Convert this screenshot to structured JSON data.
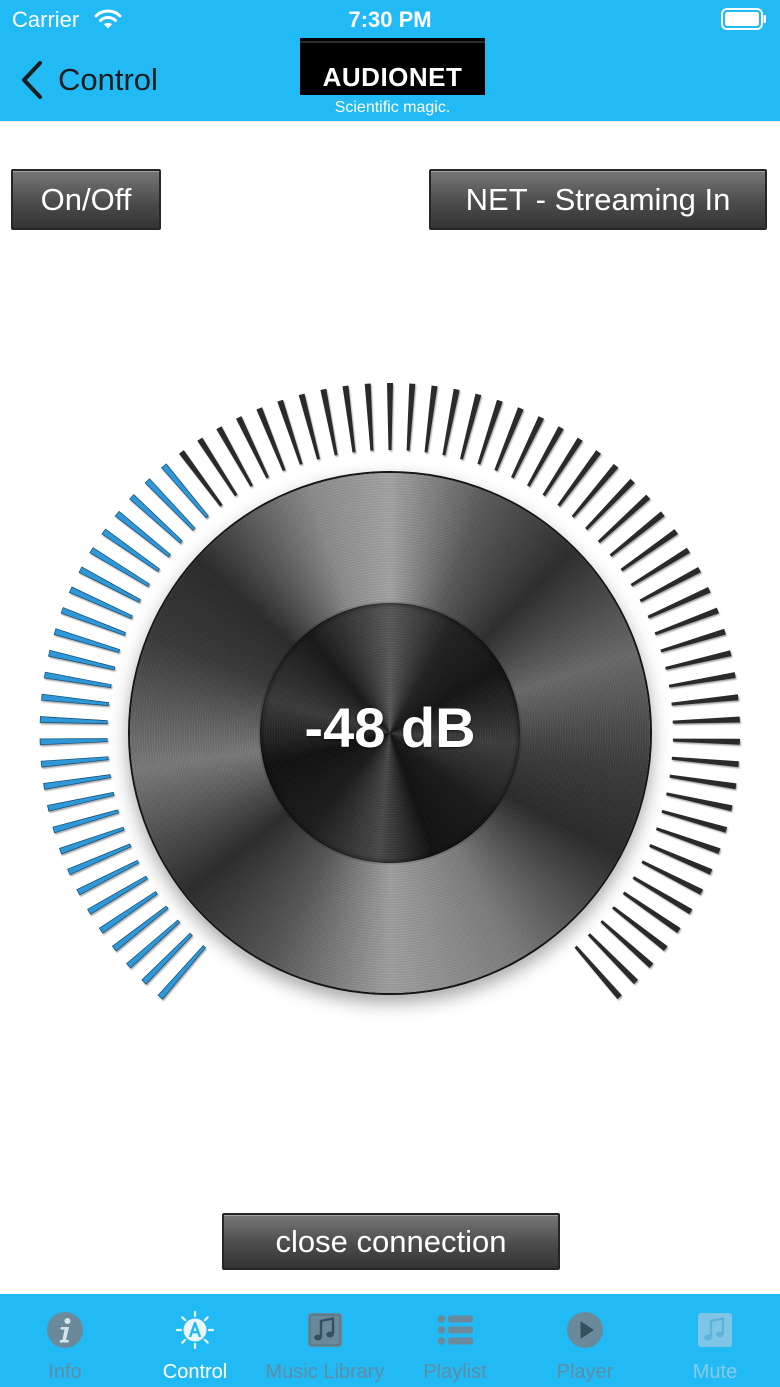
{
  "status_bar": {
    "carrier": "Carrier",
    "time": "7:30 PM",
    "wifi_icon": "wifi-icon",
    "battery_icon": "battery-icon",
    "battery_level": 1.0
  },
  "nav": {
    "back_label": "Control",
    "back_icon": "chevron-left-icon",
    "logo": {
      "brand": "AUDIONET",
      "tagline": "Scientific magic."
    }
  },
  "buttons": {
    "power": "On/Off",
    "input": "NET - Streaming In",
    "close": "close connection"
  },
  "volume": {
    "display": "-48 dB",
    "level": 0.36
  },
  "tabs": [
    {
      "label": "Info",
      "icon": "info-icon",
      "selected": false,
      "disabled": false
    },
    {
      "label": "Control",
      "icon": "control-icon",
      "selected": true,
      "disabled": false
    },
    {
      "label": "Music Library",
      "icon": "music-library-icon",
      "selected": false,
      "disabled": false
    },
    {
      "label": "Playlist",
      "icon": "playlist-icon",
      "selected": false,
      "disabled": false
    },
    {
      "label": "Player",
      "icon": "player-icon",
      "selected": false,
      "disabled": false
    },
    {
      "label": "Mute",
      "icon": "mute-icon",
      "selected": false,
      "disabled": true
    }
  ],
  "colors": {
    "accent": "#22BAF4",
    "tick_active": "#2E98D8",
    "tick_inactive": "#2A2A2A",
    "tab_label": "#5F8DA6",
    "tab_selected": "#FFFFFF",
    "tab_disabled": "#86CBE8"
  }
}
